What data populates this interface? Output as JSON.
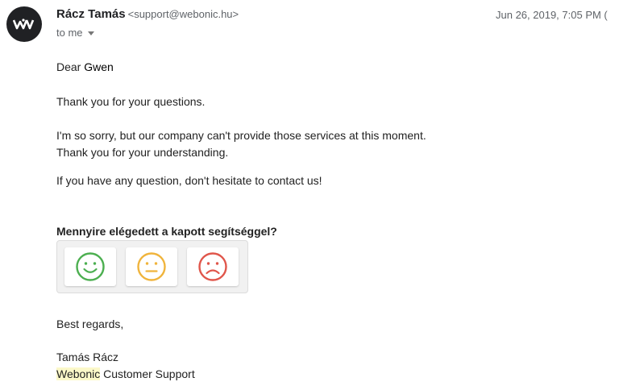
{
  "header": {
    "sender_name": "Rácz Tamás",
    "sender_email": "<support@webonic.hu>",
    "date": "Jun 26, 2019, 7:05 PM (",
    "to_label": "to me",
    "avatar_icon": "webonic-logo-icon"
  },
  "body": {
    "greeting_prefix": "Dear",
    "greeting_name": "Gwen",
    "line1": "Thank you for your questions.",
    "line2": "I'm so sorry, but our company can't provide those services at this moment.",
    "line3": "Thank you for your understanding.",
    "line4": "If you have any question, don't hesitate to contact us!"
  },
  "survey": {
    "question": "Mennyire elégedett a kapott segítséggel?",
    "options": [
      {
        "icon": "happy-face-icon",
        "color": "#4caf50"
      },
      {
        "icon": "neutral-face-icon",
        "color": "#f0b43c"
      },
      {
        "icon": "sad-face-icon",
        "color": "#e0564b"
      }
    ]
  },
  "signature": {
    "closing": "Best regards,",
    "name": "Tamás Rácz",
    "company": "Webonic",
    "team": "Customer Support"
  },
  "colors": {
    "highlight": "#fbf8c9",
    "avatar_bg": "#202124"
  }
}
